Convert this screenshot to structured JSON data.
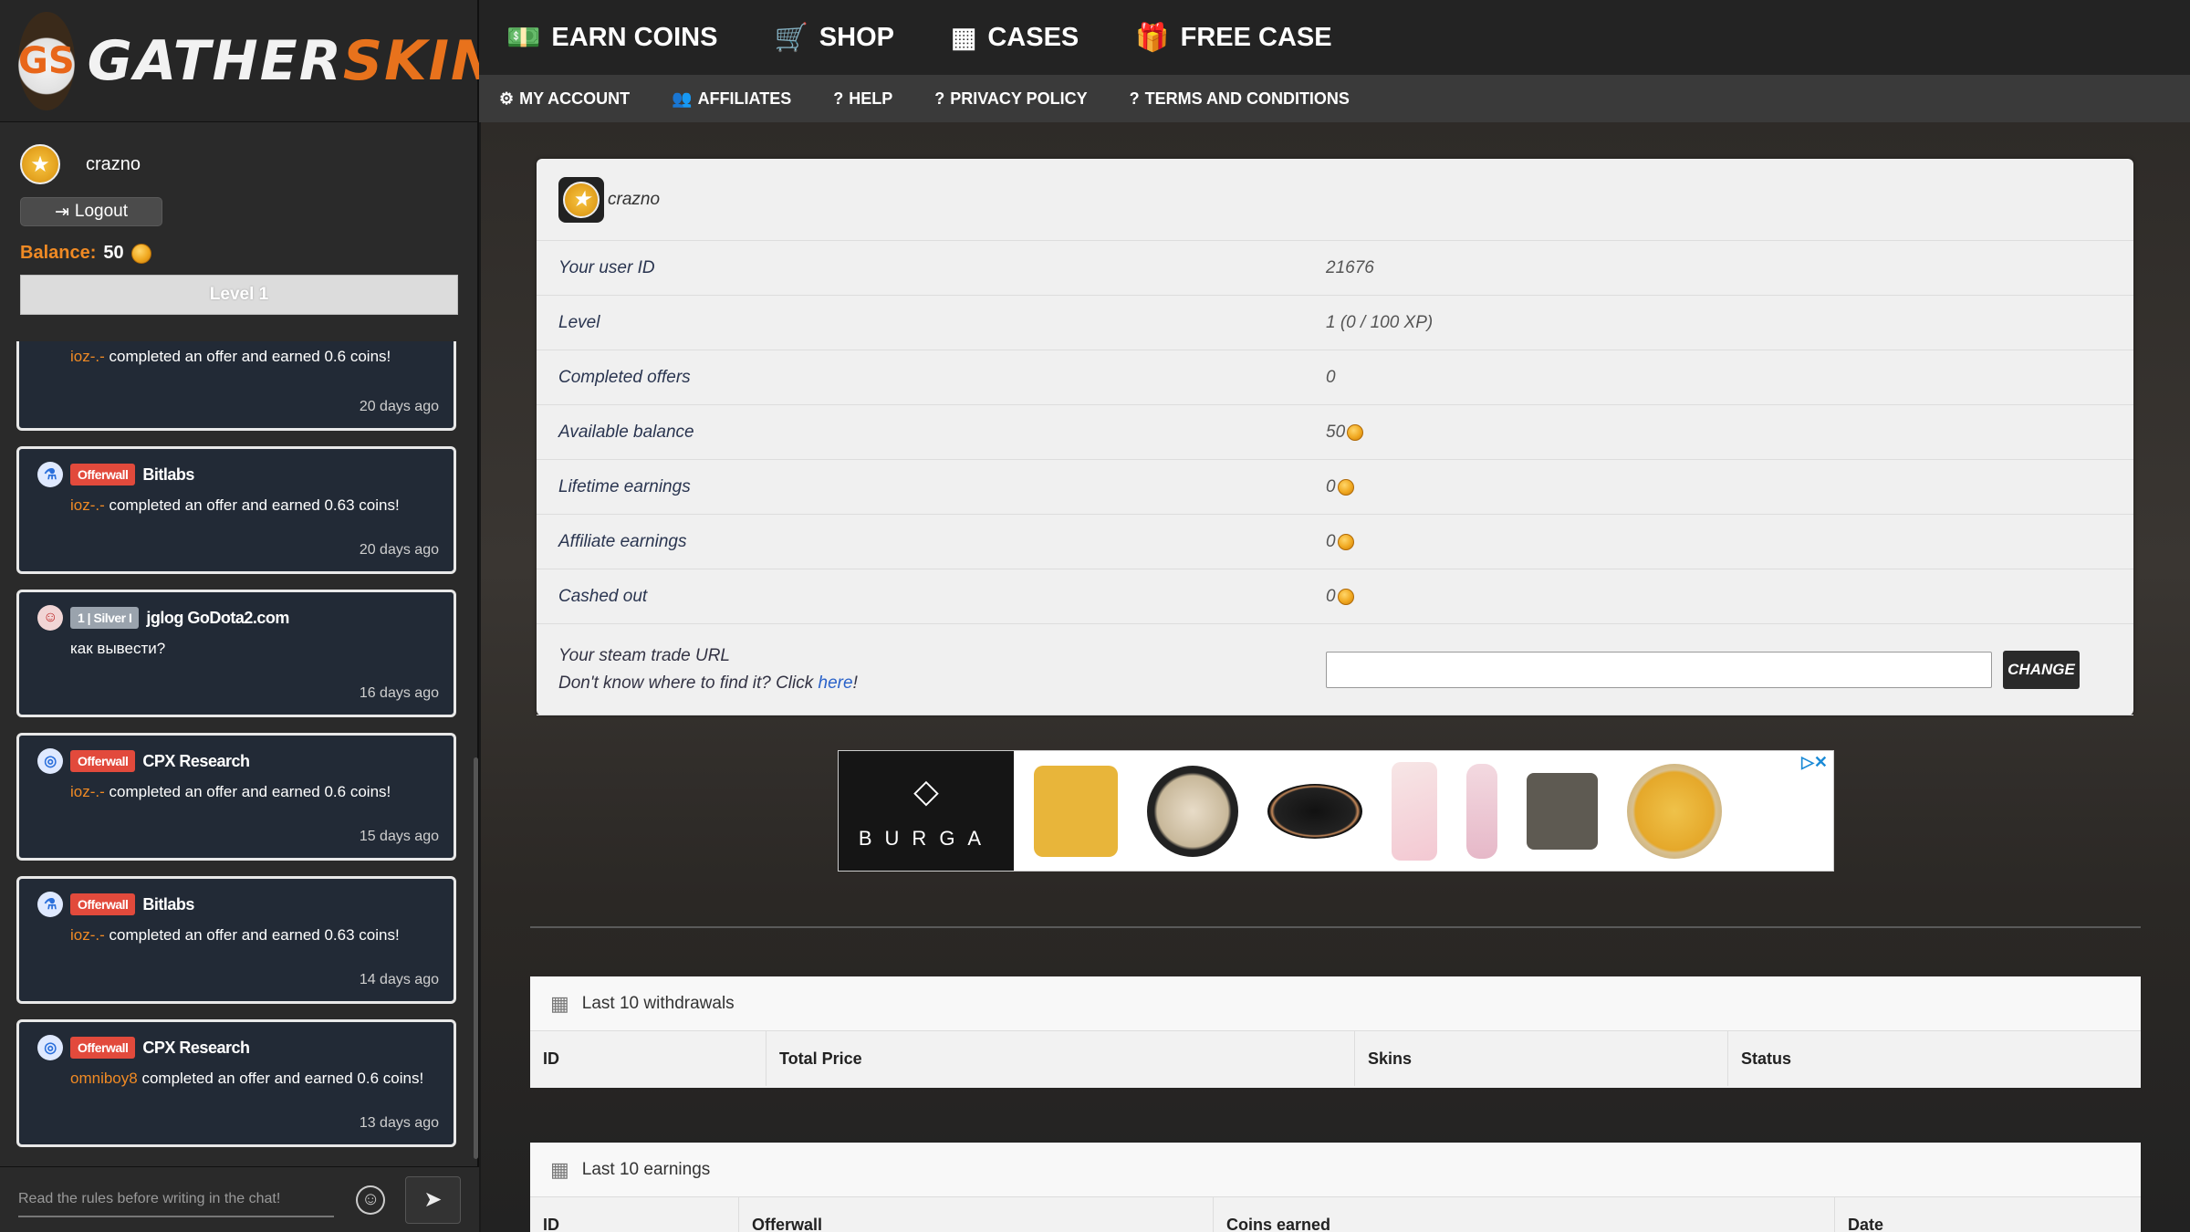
{
  "brand": {
    "logo_initials": "GS",
    "logo_part1": "GATHER",
    "logo_part2": "SKINS"
  },
  "user": {
    "name": "crazno",
    "logout_label": "Logout",
    "balance_label": "Balance:",
    "balance_value": "50",
    "level_label": "Level 1"
  },
  "feed": [
    {
      "tag": "Offerwall",
      "source": "CPX Research",
      "user": "ioz-.-",
      "text": "completed an offer and earned 0.6 coins!",
      "time": "20 days ago"
    },
    {
      "tag": "Offerwall",
      "source": "Bitlabs",
      "user": "ioz-.-",
      "text": "completed an offer and earned 0.63 coins!",
      "time": "20 days ago"
    },
    {
      "tag": "1 | Silver I",
      "source": "jglog GoDota2.com",
      "user": "",
      "text": "как вывести?",
      "time": "16 days ago"
    },
    {
      "tag": "Offerwall",
      "source": "CPX Research",
      "user": "ioz-.-",
      "text": "completed an offer and earned 0.6 coins!",
      "time": "15 days ago"
    },
    {
      "tag": "Offerwall",
      "source": "Bitlabs",
      "user": "ioz-.-",
      "text": "completed an offer and earned 0.63 coins!",
      "time": "14 days ago"
    },
    {
      "tag": "Offerwall",
      "source": "CPX Research",
      "user": "omniboy8",
      "text": "completed an offer and earned 0.6 coins!",
      "time": "13 days ago"
    }
  ],
  "chat": {
    "placeholder": "Read the rules before writing in the chat!"
  },
  "topnav": [
    {
      "label": "EARN COINS",
      "icon": "money-icon"
    },
    {
      "label": "SHOP",
      "icon": "cart-icon"
    },
    {
      "label": "CASES",
      "icon": "cases-icon"
    },
    {
      "label": "FREE CASE",
      "icon": "gift-icon"
    }
  ],
  "subnav": [
    {
      "label": "MY ACCOUNT",
      "icon": "cogs-icon"
    },
    {
      "label": "AFFILIATES",
      "icon": "users-icon"
    },
    {
      "label": "HELP",
      "icon": "question-icon"
    },
    {
      "label": "PRIVACY POLICY",
      "icon": "question-icon"
    },
    {
      "label": "TERMS AND CONDITIONS",
      "icon": "question-icon"
    }
  ],
  "profile": {
    "name": "crazno",
    "rows": [
      {
        "key": "Your user ID",
        "value": "21676"
      },
      {
        "key": "Level",
        "value": "1 (0 / 100 XP)"
      },
      {
        "key": "Completed offers",
        "value": "0"
      },
      {
        "key": "Available balance",
        "value": "50"
      },
      {
        "key": "Lifetime earnings",
        "value": "0"
      },
      {
        "key": "Affiliate earnings",
        "value": "0"
      },
      {
        "key": "Cashed out",
        "value": "0"
      }
    ],
    "steam_label": "Your steam trade URL",
    "steam_hint": "Don't know where to find it? Click ",
    "steam_hint_link": "here",
    "steam_hint_end": "!",
    "change_label": "CHANGE"
  },
  "ad": {
    "brand_word": "BURGA"
  },
  "withdrawals": {
    "title": "Last 10 withdrawals",
    "columns": [
      "ID",
      "Total Price",
      "Skins",
      "Status"
    ]
  },
  "earnings": {
    "title": "Last 10 earnings",
    "columns": [
      "ID",
      "Offerwall",
      "Coins earned",
      "Date"
    ]
  }
}
